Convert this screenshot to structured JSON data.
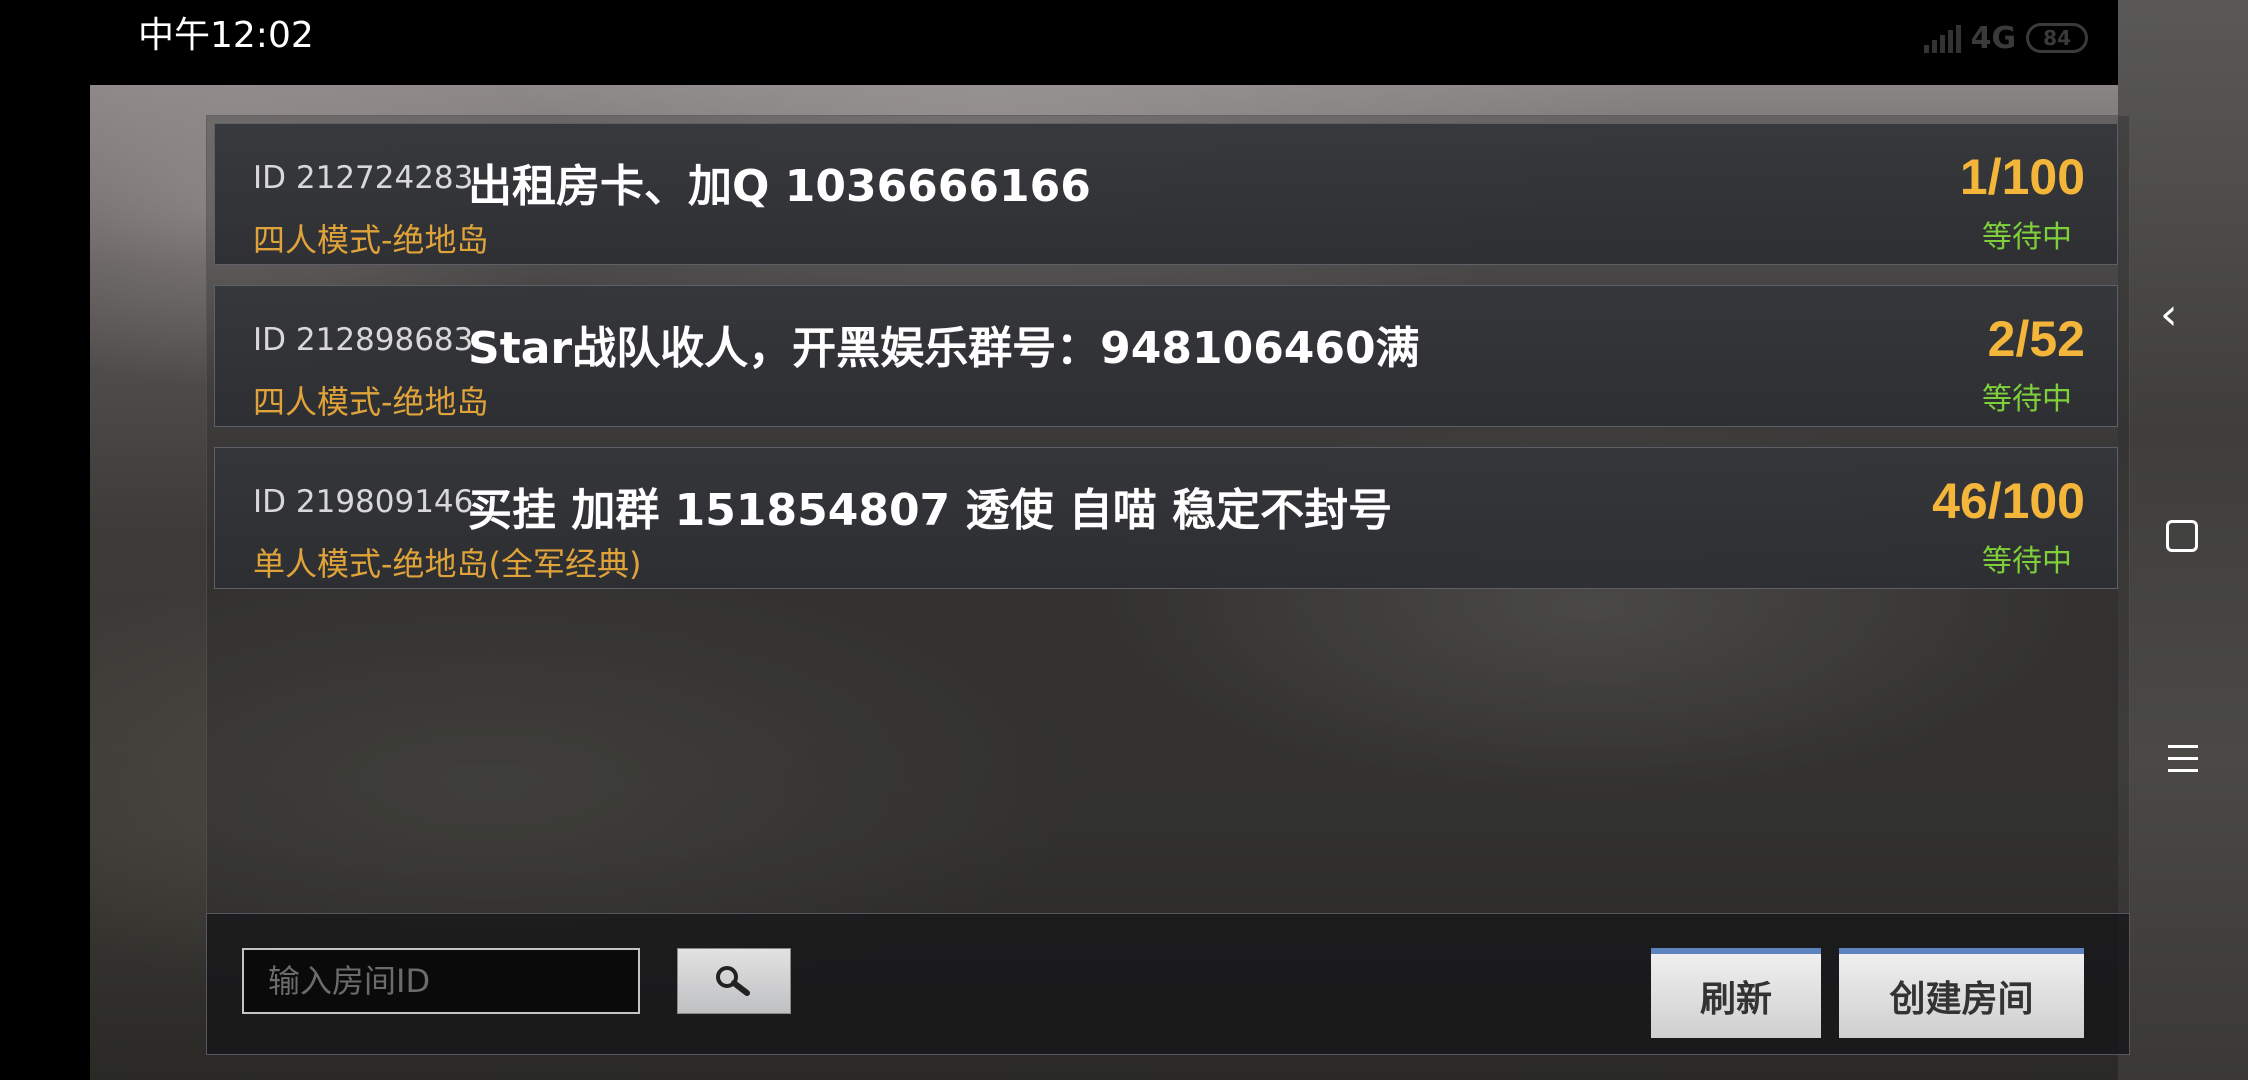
{
  "status_bar": {
    "time": "中午12:02",
    "network": "4G",
    "battery": "84"
  },
  "rooms": [
    {
      "id_label": "ID 212724283",
      "title": "出租房卡、加Q 1036666166",
      "mode": "四人模式-绝地岛",
      "count": "1/100",
      "status": "等待中"
    },
    {
      "id_label": "ID 212898683",
      "title": "Star战队收人，开黑娱乐群号：948106460满",
      "mode": "四人模式-绝地岛",
      "count": "2/52",
      "status": "等待中"
    },
    {
      "id_label": "ID 219809146",
      "title": "买挂 加群 151854807 透使 自喵 稳定不封号",
      "mode": "单人模式-绝地岛(全军经典)",
      "count": "46/100",
      "status": "等待中"
    }
  ],
  "search": {
    "placeholder": "输入房间ID",
    "value": ""
  },
  "buttons": {
    "refresh": "刷新",
    "create_room": "创建房间"
  },
  "icons": {
    "search": "search-icon",
    "back": "back-icon",
    "home": "home-icon",
    "menu": "menu-icon",
    "signal": "signal-icon",
    "battery": "battery-icon"
  },
  "colors": {
    "mode_text": "#e0a33a",
    "count_text": "#f4b53b",
    "status_text": "#7fcf3b",
    "button_accent": "#5c82c0"
  }
}
